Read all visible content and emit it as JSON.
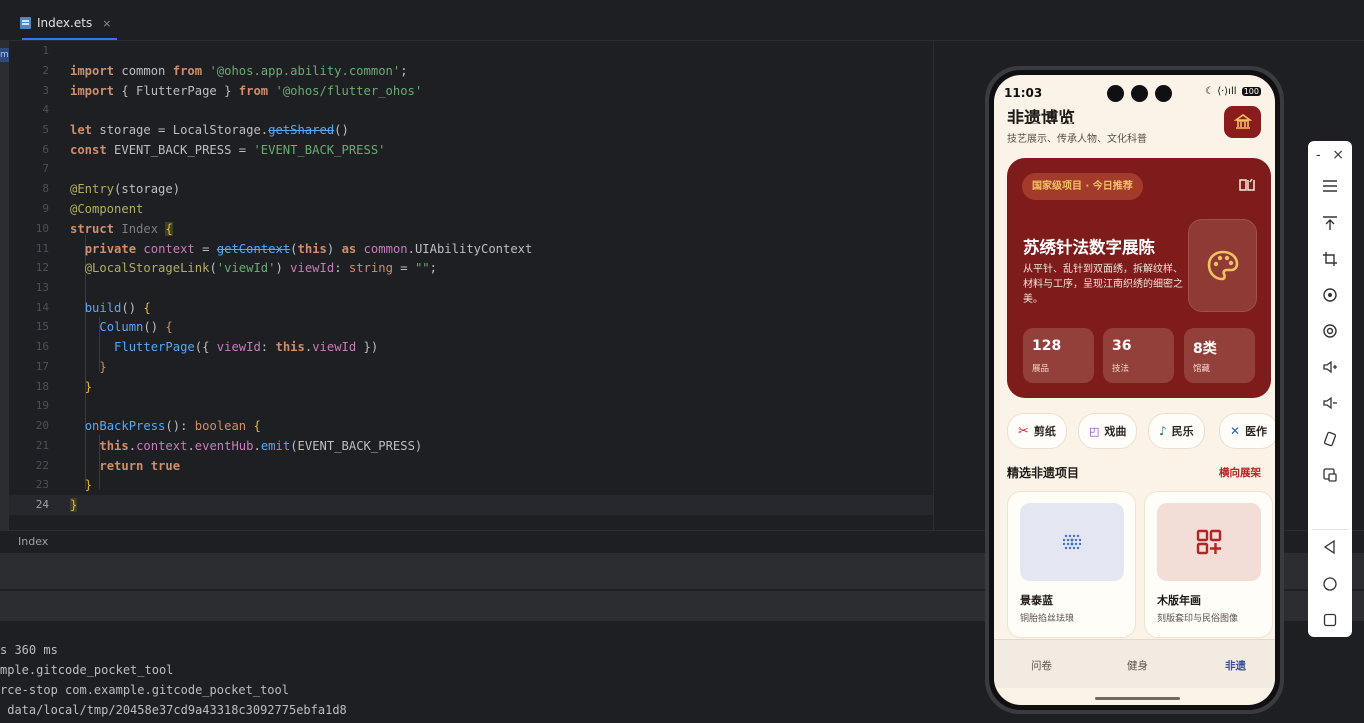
{
  "editor": {
    "tab_label": "Index.ets",
    "tab_close": "×",
    "rail_text": "m",
    "breadcrumb": "Index",
    "line_numbers": [
      "1",
      "2",
      "3",
      "4",
      "5",
      "6",
      "7",
      "8",
      "9",
      "10",
      "11",
      "12",
      "13",
      "14",
      "15",
      "16",
      "17",
      "18",
      "19",
      "20",
      "21",
      "22",
      "23",
      "24"
    ],
    "current_line": "24"
  },
  "console": {
    "lines": [
      "s 360 ms",
      "mple.gitcode_pocket_tool",
      "rce-stop com.example.gitcode_pocket_tool",
      " data/local/tmp/20458e37cd9a43318c3092775ebfa1d8"
    ]
  },
  "colors": {
    "keyword": "#cf8e6d",
    "string": "#6aab73",
    "function": "#56a8f5",
    "decorator": "#b3ae60",
    "field": "#c77dbb",
    "accent_red": "#7e1b1b",
    "tab_active": "#3b4ea0"
  },
  "phone": {
    "status_time": "11:03",
    "battery": "100",
    "app_title": "非遗博览",
    "app_subtitle": "技艺展示、传承人物、文化科普",
    "hero": {
      "badge": "国家级项目 · 今日推荐",
      "title": "苏绣针法数字展陈",
      "desc": "从平针、乱针到双面绣，拆解纹样、材料与工序，呈现江南织绣的细密之美。",
      "stats": [
        {
          "value": "128",
          "label": "展品"
        },
        {
          "value": "36",
          "label": "技法"
        },
        {
          "value": "8类",
          "label": "馆藏"
        }
      ]
    },
    "chips": [
      "剪纸",
      "戏曲",
      "民乐",
      "医作"
    ],
    "section_title": "精选非遗项目",
    "section_link": "横向展架",
    "cards": [
      {
        "title": "景泰蓝",
        "subtitle": "铜胎掐丝珐琅"
      },
      {
        "title": "木版年画",
        "subtitle": "刻版套印与民俗图像"
      }
    ],
    "tabs": [
      "问卷",
      "健身",
      "非遗"
    ],
    "active_tab": "非遗"
  },
  "emulator_toolbar": {
    "minimize": "-",
    "close": "×"
  }
}
